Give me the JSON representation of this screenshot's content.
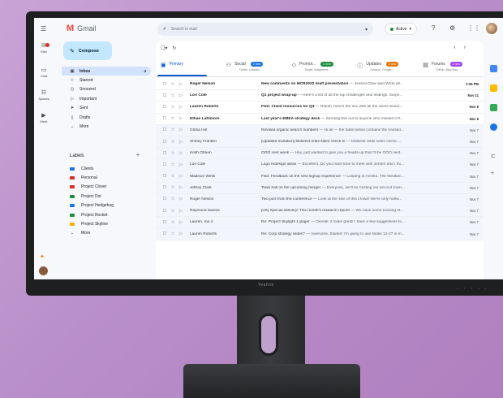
{
  "monitor": {
    "brand": "Yealink"
  },
  "app": {
    "name": "Gmail",
    "logo_letter": "M"
  },
  "rail": {
    "items": [
      {
        "label": "Mail",
        "icon": "mail-icon"
      },
      {
        "label": "Chat",
        "icon": "chat-icon"
      },
      {
        "label": "Spaces",
        "icon": "spaces-icon"
      },
      {
        "label": "Meet",
        "icon": "meet-icon"
      }
    ]
  },
  "search": {
    "placeholder": "Search in mail"
  },
  "status": {
    "label": "Active",
    "color": "#1e8e3e"
  },
  "compose": {
    "label": "Compose"
  },
  "nav": {
    "items": [
      {
        "label": "Inbox",
        "icon": "inbox-icon",
        "count": "4",
        "active": true
      },
      {
        "label": "Starred",
        "icon": "star-icon",
        "count": ""
      },
      {
        "label": "Snoozed",
        "icon": "clock-icon",
        "count": ""
      },
      {
        "label": "Important",
        "icon": "important-icon",
        "count": ""
      },
      {
        "label": "Sent",
        "icon": "send-icon",
        "count": ""
      },
      {
        "label": "Drafts",
        "icon": "draft-icon",
        "count": ""
      },
      {
        "label": "More",
        "icon": "chevron-down-icon",
        "count": ""
      }
    ]
  },
  "labels": {
    "heading": "Labels",
    "items": [
      {
        "label": "Clients",
        "color": "#1a73e8"
      },
      {
        "label": "Personal",
        "color": "#d93025"
      },
      {
        "label": "Project Clover",
        "color": "#d93025"
      },
      {
        "label": "Project Dot",
        "color": "#1e8e3e"
      },
      {
        "label": "Project Hedgehog",
        "color": "#1a73e8"
      },
      {
        "label": "Project Rocket",
        "color": "#1e8e3e"
      },
      {
        "label": "Project Skyline",
        "color": "#f9ab00"
      }
    ],
    "more": "More"
  },
  "tabs": [
    {
      "label": "Primary",
      "icon": "inbox-icon",
      "badge": "",
      "badge_color": "",
      "sub": "",
      "active": true
    },
    {
      "label": "Social",
      "icon": "people-icon",
      "badge": "2 new",
      "badge_color": "#1a73e8",
      "sub": "Twitter, LinkedIn...",
      "active": false
    },
    {
      "label": "Promot...",
      "icon": "tag-icon",
      "badge": "2 new",
      "badge_color": "#1e8e3e",
      "sub": "Target, Walgreens...",
      "active": false
    },
    {
      "label": "Updates",
      "icon": "info-icon",
      "badge": "2 new",
      "badge_color": "#e37400",
      "sub": "Amazon, Google...",
      "active": false
    },
    {
      "label": "Forums",
      "icon": "forum-icon",
      "badge": "2 new",
      "badge_color": "#a142f4",
      "sub": "Github, Blog Men...",
      "active": false
    }
  ],
  "emails": [
    {
      "sender": "Roger Nelson",
      "subject": "New comments on MCR2022 draft presentation",
      "snippet": " — Jessica Dow said What ab...",
      "date": "2:35 PM",
      "unread": true
    },
    {
      "sender": "Lori Cole",
      "subject": "Q1 project wrap-up",
      "snippet": " — Here's a list of all the top challenges and findings. Surpri...",
      "date": "Nov 11",
      "unread": true
    },
    {
      "sender": "Lauren Roberts",
      "subject": "Fwd: Client resources for Q3",
      "snippet": " — Ritesh, here's the doc with all the client resour...",
      "date": "Nov 8",
      "unread": true
    },
    {
      "sender": "Ethan Lattimore",
      "subject": "Last year's EMEA strategy deck",
      "snippet": " — Sending this out to anyone who missed it R...",
      "date": "Nov 8",
      "unread": true
    },
    {
      "sender": "Gloria Hill",
      "subject": "Revised organic search numbers",
      "snippet": " — Hi all — the table below contains the revised...",
      "date": "Nov 7",
      "unread": false
    },
    {
      "sender": "Shirley Franklin",
      "subject": "[Updated invitation] Midwest retail sales check-in",
      "snippet": " — Midwest retail sales check-...",
      "date": "Nov 7",
      "unread": false
    },
    {
      "sender": "Keith Obrien",
      "subject": "OOO next week",
      "snippet": " — Hey, just wanted to give you a heads-up that I'll be OOO next...",
      "date": "Nov 7",
      "unread": false
    },
    {
      "sender": "Lori Cole",
      "subject": "Logo redesign ideas",
      "snippet": " — Excellent. Do you have time to meet with Jeroen and I thi...",
      "date": "Nov 7",
      "unread": false
    },
    {
      "sender": "Madison Wells",
      "subject": "Fwd: Feedback on the new signup experience",
      "snippet": " — Looping in Annika. The feedbac...",
      "date": "Nov 7",
      "unread": false
    },
    {
      "sender": "Jeffrey Clark",
      "subject": "Town hall on the upcoming merger",
      "snippet": " — Everyone, we'll be hosting our second town...",
      "date": "Nov 7",
      "unread": false
    },
    {
      "sender": "Roger Nelson",
      "subject": "Two pics from the conference",
      "snippet": " — Look at the size of this crowd! We're only halfw...",
      "date": "Nov 7",
      "unread": false
    },
    {
      "sender": "Raymond Santos",
      "subject": "[UX] Special delivery! This month's research report!",
      "snippet": " — We have some exciting st...",
      "date": "Nov 7",
      "unread": false
    },
    {
      "sender": "Lauren, me  4",
      "subject": "Re: Project Skylight 1-pager",
      "snippet": " — Overall, it looks great! I have a few suggestions fo...",
      "date": "Nov 7",
      "unread": false
    },
    {
      "sender": "Lauren Roberts",
      "subject": "Re: Corp strategy slides?",
      "snippet": " — Awesome, thanks! I'm going to use slides 12-27 in m...",
      "date": "Nov 7",
      "unread": false
    }
  ]
}
